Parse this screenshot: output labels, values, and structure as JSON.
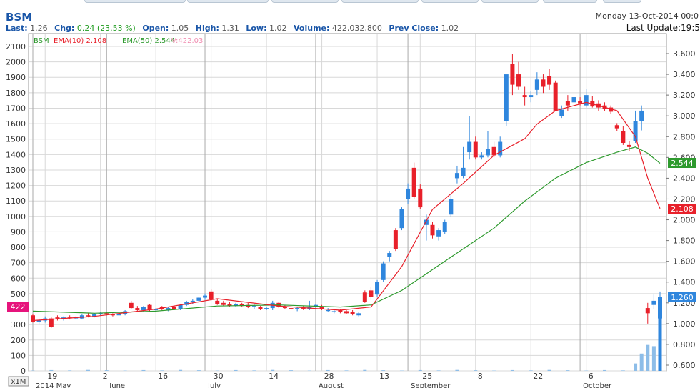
{
  "header": {
    "symbol": "BSM",
    "date": "Monday 13-Oct-2014 00:0",
    "last_update": "Last Update:19:5",
    "quote": {
      "last_label": "Last:",
      "last": "1.26",
      "chg_label": "Chg:",
      "chg": "0.24 (23.53 %)",
      "open_label": "Open:",
      "open": "1.05",
      "high_label": "High:",
      "high": "1.31",
      "low_label": "Low:",
      "low": "1.02",
      "volume_label": "Volume:",
      "volume": "422,032,800",
      "prev_label": "Prev Close:",
      "prev": "1.02"
    }
  },
  "legend": {
    "symbol": "BSM",
    "ema10": "EMA(10) 2.108",
    "ema50": "EMA(50) 2.544",
    "volume": "V:422.03"
  },
  "colors": {
    "up": "#2f86dd",
    "down": "#e8202a",
    "ema10": "#e8202a",
    "ema50": "#2e9a2e",
    "grid": "#d8d8d8",
    "volume": "#8dbde8",
    "volume_badge": "#e6147c"
  },
  "badges": {
    "ema50": "2.544",
    "ema10": "2.108",
    "last": "1.260",
    "volume": "422"
  },
  "zoom_button": "x1M",
  "chart_data": {
    "type": "candlestick",
    "price_axis": {
      "ticks": [
        "3.600",
        "3.400",
        "3.200",
        "3.000",
        "2.800",
        "2.600",
        "2.400",
        "2.200",
        "2.000",
        "1.800",
        "1.600",
        "1.400",
        "1.200",
        "1.000",
        "0.800",
        "0.600"
      ]
    },
    "volume_axis": {
      "ticks": [
        "2100",
        "2000",
        "1900",
        "1800",
        "1700",
        "1600",
        "1500",
        "1400",
        "1300",
        "1200",
        "1100",
        "1000",
        "900",
        "800",
        "700",
        "600",
        "500",
        "400",
        "300",
        "200",
        "100",
        "0"
      ]
    },
    "x_ticks": [
      "19",
      "2",
      "16",
      "30",
      "14",
      "28",
      "13",
      "25",
      "8",
      "22",
      "6"
    ],
    "month_labels": [
      "2014 May",
      "June",
      "July",
      "August",
      "September",
      "October"
    ],
    "ema10_last": 2.108,
    "ema50_last": 2.544,
    "candles": [
      [
        1.08,
        1.09,
        1.01,
        1.02
      ],
      [
        1.02,
        1.05,
        0.99,
        1.03
      ],
      [
        1.03,
        1.07,
        1.01,
        1.05
      ],
      [
        1.05,
        1.06,
        0.96,
        0.97
      ],
      [
        1.06,
        1.08,
        1.03,
        1.05
      ],
      [
        1.05,
        1.07,
        1.03,
        1.06
      ],
      [
        1.06,
        1.08,
        1.04,
        1.05
      ],
      [
        1.05,
        1.07,
        1.04,
        1.06
      ],
      [
        1.05,
        1.09,
        1.04,
        1.08
      ],
      [
        1.08,
        1.1,
        1.06,
        1.07
      ],
      [
        1.07,
        1.1,
        1.06,
        1.09
      ],
      [
        1.09,
        1.11,
        1.08,
        1.1
      ],
      [
        1.1,
        1.11,
        1.08,
        1.09
      ],
      [
        1.09,
        1.1,
        1.07,
        1.08
      ],
      [
        1.08,
        1.1,
        1.07,
        1.09
      ],
      [
        1.09,
        1.13,
        1.08,
        1.12
      ],
      [
        1.2,
        1.22,
        1.14,
        1.15
      ],
      [
        1.15,
        1.17,
        1.12,
        1.13
      ],
      [
        1.13,
        1.17,
        1.11,
        1.16
      ],
      [
        1.18,
        1.19,
        1.12,
        1.13
      ],
      [
        1.13,
        1.15,
        1.12,
        1.14
      ],
      [
        1.16,
        1.17,
        1.13,
        1.14
      ],
      [
        1.13,
        1.16,
        1.12,
        1.15
      ],
      [
        1.16,
        1.17,
        1.13,
        1.14
      ],
      [
        1.14,
        1.19,
        1.13,
        1.18
      ],
      [
        1.18,
        1.22,
        1.17,
        1.21
      ],
      [
        1.21,
        1.24,
        1.19,
        1.22
      ],
      [
        1.22,
        1.26,
        1.2,
        1.25
      ],
      [
        1.25,
        1.29,
        1.23,
        1.27
      ],
      [
        1.31,
        1.33,
        1.22,
        1.24
      ],
      [
        1.22,
        1.24,
        1.18,
        1.19
      ],
      [
        1.2,
        1.22,
        1.17,
        1.18
      ],
      [
        1.19,
        1.21,
        1.16,
        1.17
      ],
      [
        1.17,
        1.2,
        1.16,
        1.19
      ],
      [
        1.19,
        1.2,
        1.16,
        1.17
      ],
      [
        1.18,
        1.2,
        1.15,
        1.16
      ],
      [
        1.16,
        1.19,
        1.14,
        1.17
      ],
      [
        1.16,
        1.17,
        1.13,
        1.14
      ],
      [
        1.14,
        1.16,
        1.13,
        1.15
      ],
      [
        1.15,
        1.22,
        1.13,
        1.2
      ],
      [
        1.2,
        1.21,
        1.15,
        1.16
      ],
      [
        1.16,
        1.18,
        1.14,
        1.15
      ],
      [
        1.15,
        1.17,
        1.13,
        1.14
      ],
      [
        1.14,
        1.16,
        1.12,
        1.15
      ],
      [
        1.15,
        1.17,
        1.13,
        1.14
      ],
      [
        1.14,
        1.22,
        1.13,
        1.16
      ],
      [
        1.16,
        1.19,
        1.14,
        1.18
      ],
      [
        1.16,
        1.18,
        1.13,
        1.14
      ],
      [
        1.13,
        1.15,
        1.11,
        1.13
      ],
      [
        1.11,
        1.13,
        1.1,
        1.12
      ],
      [
        1.13,
        1.14,
        1.1,
        1.11
      ],
      [
        1.12,
        1.13,
        1.09,
        1.1
      ],
      [
        1.11,
        1.13,
        1.08,
        1.09
      ],
      [
        1.08,
        1.11,
        1.07,
        1.1
      ],
      [
        1.3,
        1.32,
        1.2,
        1.21
      ],
      [
        1.32,
        1.35,
        1.23,
        1.26
      ],
      [
        1.28,
        1.42,
        1.26,
        1.4
      ],
      [
        1.42,
        1.6,
        1.4,
        1.58
      ],
      [
        1.64,
        1.7,
        1.6,
        1.68
      ],
      [
        1.9,
        1.92,
        1.7,
        1.72
      ],
      [
        1.92,
        2.12,
        1.9,
        2.1
      ],
      [
        2.2,
        2.35,
        2.15,
        2.3
      ],
      [
        2.5,
        2.55,
        2.2,
        2.22
      ],
      [
        2.3,
        2.34,
        2.1,
        2.12
      ],
      [
        1.95,
        2.05,
        1.8,
        2.0
      ],
      [
        1.95,
        1.98,
        1.82,
        1.85
      ],
      [
        1.84,
        1.92,
        1.8,
        1.9
      ],
      [
        1.88,
        2.0,
        1.86,
        1.98
      ],
      [
        2.05,
        2.25,
        2.03,
        2.2
      ],
      [
        2.4,
        2.52,
        2.35,
        2.45
      ],
      [
        2.42,
        2.7,
        2.4,
        2.5
      ],
      [
        2.65,
        3.0,
        2.58,
        2.75
      ],
      [
        2.75,
        2.8,
        2.58,
        2.6
      ],
      [
        2.6,
        2.65,
        2.58,
        2.62
      ],
      [
        2.62,
        2.85,
        2.6,
        2.68
      ],
      [
        2.7,
        2.75,
        2.6,
        2.62
      ],
      [
        2.62,
        2.8,
        2.6,
        2.75
      ],
      [
        2.95,
        3.35,
        2.9,
        3.4
      ],
      [
        3.5,
        3.6,
        3.2,
        3.3
      ],
      [
        3.4,
        3.52,
        3.25,
        3.28
      ],
      [
        3.2,
        3.28,
        3.1,
        3.18
      ],
      [
        3.18,
        3.24,
        3.13,
        3.2
      ],
      [
        3.25,
        3.42,
        3.2,
        3.35
      ],
      [
        3.35,
        3.4,
        3.22,
        3.28
      ],
      [
        3.38,
        3.45,
        3.25,
        3.3
      ],
      [
        3.32,
        3.34,
        3.05,
        3.05
      ],
      [
        3.0,
        3.1,
        2.98,
        3.06
      ],
      [
        3.14,
        3.2,
        3.05,
        3.1
      ],
      [
        3.13,
        3.22,
        3.1,
        3.18
      ],
      [
        3.14,
        3.18,
        3.1,
        3.12
      ],
      [
        3.1,
        3.26,
        3.08,
        3.2
      ],
      [
        3.14,
        3.19,
        3.08,
        3.09
      ],
      [
        3.12,
        3.15,
        3.05,
        3.08
      ],
      [
        3.1,
        3.13,
        3.05,
        3.07
      ],
      [
        3.08,
        3.1,
        3.02,
        3.04
      ],
      [
        2.91,
        2.93,
        2.85,
        2.88
      ],
      [
        2.85,
        2.9,
        2.72,
        2.74
      ],
      [
        2.72,
        2.76,
        2.66,
        2.7
      ],
      [
        2.76,
        3.05,
        2.74,
        2.95
      ],
      [
        2.95,
        3.1,
        2.86,
        3.05
      ],
      [
        1.15,
        1.2,
        1.0,
        1.1
      ],
      [
        1.18,
        1.28,
        1.14,
        1.22
      ],
      [
        1.05,
        1.31,
        1.02,
        1.26
      ]
    ],
    "ema10": [
      [
        0,
        1.03
      ],
      [
        10,
        1.07
      ],
      [
        20,
        1.14
      ],
      [
        30,
        1.24
      ],
      [
        40,
        1.17
      ],
      [
        50,
        1.13
      ],
      [
        55,
        1.16
      ],
      [
        60,
        1.55
      ],
      [
        65,
        2.1
      ],
      [
        70,
        2.35
      ],
      [
        75,
        2.62
      ],
      [
        80,
        2.78
      ],
      [
        82,
        2.92
      ],
      [
        85,
        3.05
      ],
      [
        90,
        3.13
      ],
      [
        95,
        3.05
      ],
      [
        98,
        2.8
      ],
      [
        100,
        2.4
      ],
      [
        102,
        2.108
      ]
    ],
    "ema50": [
      [
        0,
        1.12
      ],
      [
        10,
        1.1
      ],
      [
        20,
        1.12
      ],
      [
        30,
        1.17
      ],
      [
        40,
        1.18
      ],
      [
        50,
        1.16
      ],
      [
        55,
        1.18
      ],
      [
        60,
        1.32
      ],
      [
        65,
        1.52
      ],
      [
        70,
        1.72
      ],
      [
        75,
        1.92
      ],
      [
        80,
        2.18
      ],
      [
        85,
        2.4
      ],
      [
        90,
        2.55
      ],
      [
        95,
        2.65
      ],
      [
        98,
        2.7
      ],
      [
        100,
        2.64
      ],
      [
        102,
        2.544
      ]
    ],
    "volume_recent": [
      12,
      28,
      42,
      40,
      88
    ]
  }
}
